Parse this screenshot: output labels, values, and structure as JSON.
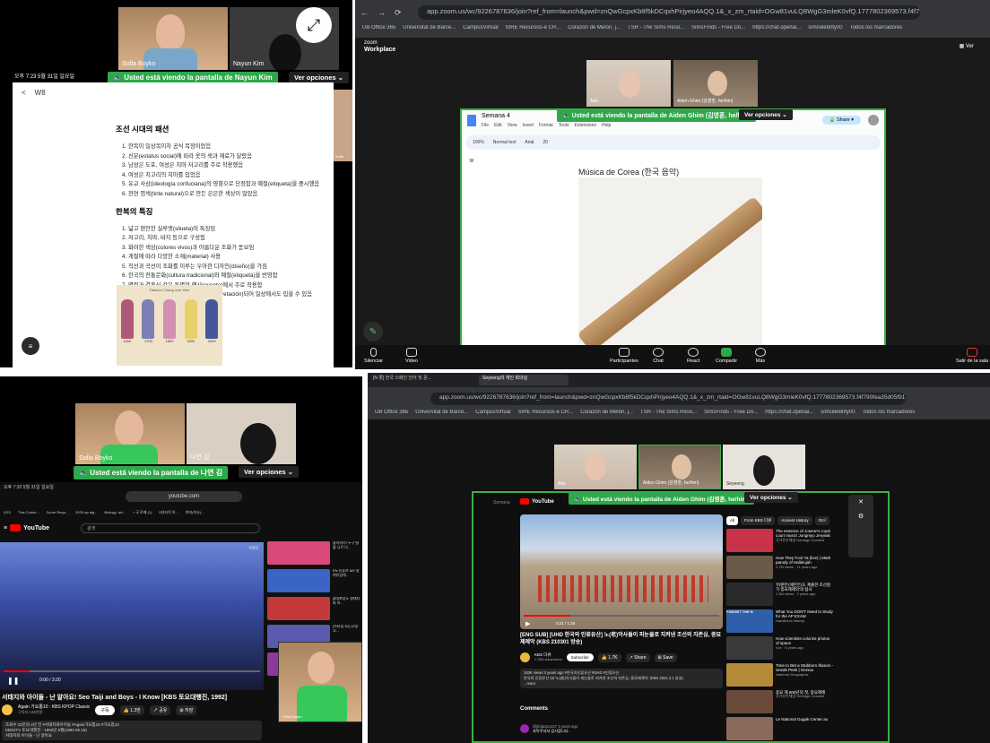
{
  "q1": {
    "participants": [
      "Sofia Boyko",
      "Nayun Kim"
    ],
    "side_participant": "Sofia",
    "banner": "Usted está viendo la pantalla de Nayun Kim",
    "options": "Ver opciones",
    "status_time": "오후 7:23  5월 31일 일요일",
    "back": "<",
    "doc_title": "W8",
    "heading1": "조선 시대의 패션",
    "list1": [
      "한복이 일상복이자 공식 복장이었음",
      "신분(estatus social)에 따라 옷의 색과 재료가 달랐음",
      "남성은 도포, 여성은 치마 저고리를 주로 착용했음",
      "여성은 치고리의 치마를 입었음",
      "유교 사상(ideología confuciana)의 영향으로 단정함과 예절(etiqueta)을 중시했음",
      "천연 염색(tinte natural)으로 만든 은은한 색상이 많았음"
    ],
    "heading2": "한복의 특징",
    "list2": [
      "넓고 편안한 실루엣(silueta)이 특징임",
      "저고리, 치마, 바지 등으로 구성됨",
      "화려한 색상(colores vivos)과 아름다운 조화가 돋보임",
      "계절에 따라 다양한 소재(material) 사용",
      "직선과 곡선이 조화를 이루는 우아한 디자인(diseño)을 가짐",
      "한국의 전통문화(cultura tradicional)와 예절(etiqueta)을 반영함",
      "명절과 결혼식 같은 특별한 행사(evento)에서 주로 착용함",
      "현대에는 기존 한복으로 재해석(reinterpretación)되어 일상에서도 입을 수 있음"
    ],
    "img_caption": "Fashion Chang over time",
    "img_labels": [
      "1500",
      "1700",
      "1800",
      "1900",
      "2000"
    ]
  },
  "q2": {
    "url": "app.zoom.us/wc/9226787636/join?ref_from=launch&pwd=znQwGcpxKb8f5kDCqxhPirjyeo4AQQ.1&_x_zm_rtaid=OGw81vuLQ8WgG3mleK0vfQ.1777802369573.f4f790fea35d05f917...",
    "bookmarks": [
      "UB Office 365",
      "Universitat de Barce...",
      "CampusVirtual",
      "SIRE Recursos-e CR...",
      "Corazón de Melón, j...",
      "TSR - The Sims Reso...",
      "SimsFinds - Free Do...",
      "https://chat.openai...",
      "simcelebrity00",
      "Todos los marcadores"
    ],
    "zoom_brand": "zoom",
    "zoom_brand2": "Workplace",
    "view": "Ver",
    "participants": [
      "Ada",
      "Aiden Ghim (김영훈, he/him)"
    ],
    "banner": "Usted está viendo la pantalla de Aiden Ghim (김영훈, he/him)",
    "options": "Ver opciones",
    "doc_title": "Semana 4",
    "doc_menu": [
      "File",
      "Edit",
      "View",
      "Insert",
      "Format",
      "Tools",
      "Extensions",
      "Help"
    ],
    "share": "Share",
    "toolbar": [
      "100%",
      "Normal text",
      "Arial",
      "20"
    ],
    "doc_heading": "Música de Corea (한국 음악)",
    "controls": [
      "Silenciar",
      "Video",
      "Participantes",
      "Chat",
      "React",
      "Compartir",
      "Más"
    ],
    "participant_count": "3",
    "leave": "Salir de la sala"
  },
  "q3": {
    "participants": [
      "Sofia Boyko",
      "나연 김"
    ],
    "banner": "Usted está viendo la pantalla de 나연 김",
    "options": "Ver opciones",
    "status_time": "오후 7:32  5월 31일 일요일",
    "site": "youtube.com",
    "tabs": [
      "2GS",
      "This Conne...",
      "Score Requ...",
      "2025 ap alg...",
      "Biology, twi...",
      "+ 국 로째 (1)",
      "5대지적 아...",
      "취미(의사)..."
    ],
    "yt_logo": "YouTube",
    "search_placeholder": "검색",
    "channel_mark": "KBS",
    "time": "0:00 / 3:20",
    "video_title": "서태지와 아이들 - 난 알아요! Seo Taiji and Boys - I Know [KBS 토요대행진, 1992]",
    "channel": "Again 가요톱10 : KBS KPOP Classic",
    "subs": "구독자 124만명",
    "subscribe": "구독",
    "likes": "1.3만",
    "share": "공유",
    "save": "저장",
    "desc": [
      "조회수 23만회  2년 전  #서태지와아이들 #Again가요톱10 #가요톱10",
      "KBS2TV 토요대행진 - 1992년 5월(1992.05.16)",
      "서태지와 아이들 - 난 알아요"
    ],
    "pip_name": "Sofia Boyko",
    "side_items": [
      "좋아하기! 누구 탈출 니르 다...",
      "EN 유튜브 MV 알 여유있데...",
      "[8대포함도 생태지와 아...",
      "[가요업 30] 10일 고...",
      "[7대편전] 생..."
    ]
  },
  "q4": {
    "tabs": [
      "[N 롯] 한국 스페인 언어 및 문...",
      "Seyeong의 개인 회의실"
    ],
    "url": "app.zoom.us/wc/9226787636/join?ref_from=launch&pwd=znQwGcpxKb8f5kDCqxhPirjyeo4AQQ.1&_x_zm_rtaid=OGw81vuLQ8WgG3mleK0vfQ.1777802369573.f4f790fea35d05f917...",
    "bookmarks": [
      "UB Office 365",
      "Universitat de Barce...",
      "CampusVirtual",
      "SIRE Recursos-e CR...",
      "Corazón de Melón, j...",
      "TSR - The Sims Reso...",
      "SimsFinds - Free Do...",
      "https://chat.openai...",
      "simcelebrity00",
      "Todos los marcadores"
    ],
    "participants": [
      "Ada",
      "Aiden Ghim (김영훈, he/him)",
      "Seyeong"
    ],
    "banner": "Usted está viendo la pantalla de Aiden Ghim (김영훈, he/him)",
    "options": "Ver opciones",
    "doc_label": "Semana",
    "time": "0:21 / 1:25",
    "video_title": "[ENG SUB] [UHD 한국의 인류유산] 노(老)악사들이 피눈물로 지켜낸 조선의 자존심, 종묘제례악 (KBS 210301 방송)",
    "channel": "KBS 다큐",
    "subs": "1.78M subscribers",
    "subscribe": "Subscribe",
    "likes": "1.7K",
    "share": "Share",
    "save": "Save",
    "desc": [
      "163K views  3 years ago  #한국의인류유산 #UHD #인류유산",
      "한국의 인류유산 18 '노(老)악사들이 피눈물로 지켜낸 조선의 자존심, 종묘제례악' (KBS 2021.3.1 방송)",
      "...more"
    ],
    "comments": "Comments",
    "comment_user": "@jihdpop1227  3 years ago",
    "comment": "자막주셔서 감사합니다.",
    "chips": [
      "All",
      "From KBS 다큐",
      "Ancient History",
      "GIcl"
    ],
    "related": [
      {
        "title": "The essence of Joseon's royal court music! Jongmyo Jeryeak",
        "meta": "국가유산채널 Heritage Channel"
      },
      {
        "title": "How They Fool Ya (live) | Math parody of Hallelujah",
        "meta": "1.7M views · 11 years ago"
      },
      {
        "title": "'피렌킨'(애만은)도 제출한 조선왕가 종묘제례악'의 탐사",
        "meta": "1.5M views · 2 years ago"
      },
      {
        "title": "What You DON'T Need to Study for the AP EXAM",
        "meta": "Hamilton's History"
      },
      {
        "title": "How scientists colorize photos of space",
        "meta": "Vox · 6 years ago"
      },
      {
        "title": "Time to Bet a Stubborn Illusion - Sneak Peek | Genius",
        "meta": "National Geographic"
      },
      {
        "title": "종묘 제 600년의 첫, 종묘제례",
        "meta": "국가유산채널 Heritage Channel"
      },
      {
        "title": "Le National Gugak Center au",
        "meta": ""
      }
    ],
    "thumb_text": [
      "",
      "",
      "",
      "FORGET THE R",
      "",
      "",
      "",
      ""
    ]
  }
}
